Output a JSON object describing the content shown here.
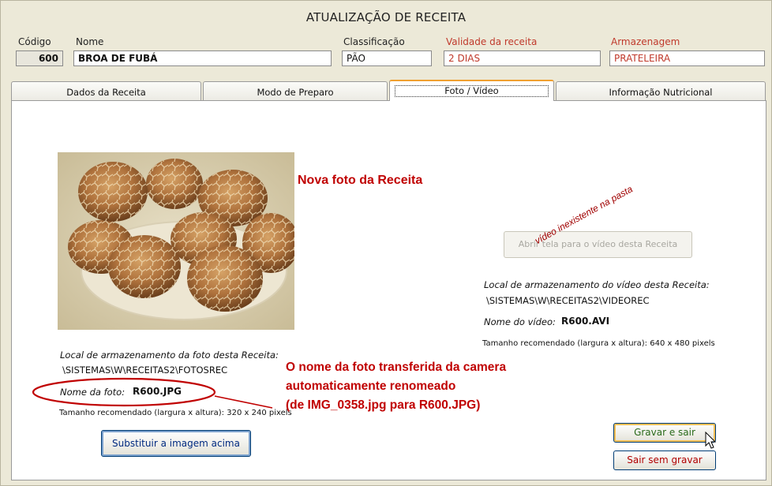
{
  "window": {
    "title": "ATUALIZAÇÃO DE RECEITA"
  },
  "header": {
    "codigo_label": "Código",
    "codigo_value": "600",
    "nome_label": "Nome",
    "nome_value": "BROA DE FUBÁ",
    "classificacao_label": "Classificação",
    "classificacao_value": "PÃO",
    "validade_label": "Validade da receita",
    "validade_value": "2 DIAS",
    "armazenagem_label": "Armazenagem",
    "armazenagem_value": "PRATELEIRA"
  },
  "tabs": [
    {
      "label": "Dados da Receita"
    },
    {
      "label": "Modo de Preparo"
    },
    {
      "label": "Foto / Vídeo"
    },
    {
      "label": "Informação Nutricional"
    }
  ],
  "photo": {
    "storage_label": "Local de armazenamento da foto desta Receita:",
    "storage_path": "\\SISTEMAS\\W\\RECEITAS2\\FOTOSREC",
    "name_label": "Nome da foto:",
    "name_value": "R600.JPG",
    "size_hint": "Tamanho recomendado (largura x altura): 320 x 240 pixels",
    "replace_button": "Substituir a imagem acima"
  },
  "video": {
    "open_button": "Abrir tela para o vídeo desta Receita",
    "storage_label": "Local de armazenamento do vídeo desta Receita:",
    "storage_path": "\\SISTEMAS\\W\\RECEITAS2\\VIDEOREC",
    "name_label": "Nome do vídeo:",
    "name_value": "R600.AVI",
    "size_hint": "Tamanho recomendado (largura x altura): 640 x 480 pixels"
  },
  "annotations": {
    "new_photo": "Nova foto da Receita",
    "video_missing": "vídeo inexistente na pasta",
    "rename_line1": "O nome da foto transferida da camera",
    "rename_line2": "automaticamente renomeado",
    "rename_line3": "(de IMG_0358.jpg para R600.JPG)",
    "color": "#c00000"
  },
  "actions": {
    "save_exit": "Gravar e sair",
    "exit_no_save": "Sair sem gravar"
  }
}
